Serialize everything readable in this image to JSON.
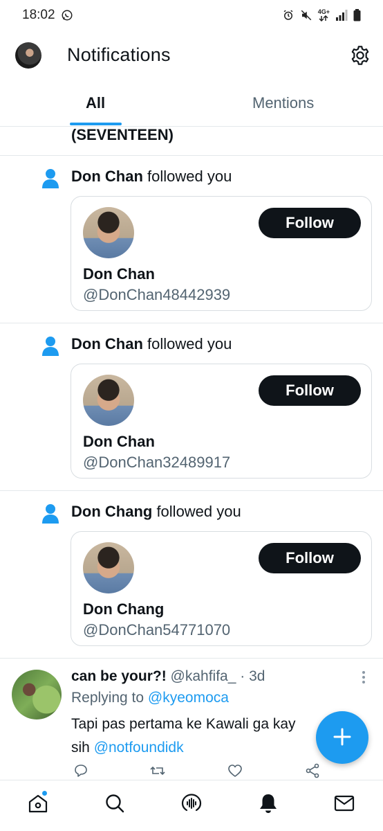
{
  "status_bar": {
    "time": "18:02",
    "network_label": "4G+",
    "icons": [
      "whatsapp-icon",
      "alarm-icon",
      "mute-icon",
      "network-icon",
      "signal-icon",
      "battery-icon"
    ]
  },
  "header": {
    "title": "Notifications",
    "icons": [
      "avatar",
      "gear-icon"
    ]
  },
  "tabs": [
    {
      "label": "All",
      "selected": true
    },
    {
      "label": "Mentions",
      "selected": false
    }
  ],
  "truncated_text": "(SEVENTEEN)",
  "notifications": [
    {
      "actor": "Don Chan",
      "action": " followed you",
      "card": {
        "name": "Don Chan",
        "handle": "@DonChan48442939",
        "button": "Follow"
      }
    },
    {
      "actor": "Don Chan",
      "action": " followed you",
      "card": {
        "name": "Don Chan",
        "handle": "@DonChan32489917",
        "button": "Follow"
      }
    },
    {
      "actor": "Don Chang",
      "action": " followed you",
      "card": {
        "name": "Don Chang",
        "handle": "@DonChan54771070",
        "button": "Follow"
      }
    }
  ],
  "tweet": {
    "display_name": "can be your?!",
    "handle": "@kahfifa_",
    "separator": " · ",
    "time": "3d",
    "replying_label": "Replying to ",
    "replying_to": "@kyeomoca",
    "body_text": "Tapi pas pertama ke Kawali ga kay",
    "body_line2": "sih ",
    "body_mention": "@notfoundidk"
  },
  "fab": {
    "icon": "plus-icon"
  },
  "bottom_nav": [
    {
      "icon": "home-icon",
      "has_dot": true
    },
    {
      "icon": "search-icon"
    },
    {
      "icon": "spaces-icon"
    },
    {
      "icon": "bell-icon",
      "selected": true
    },
    {
      "icon": "mail-icon"
    }
  ],
  "colors": {
    "accent": "#1d9bf0",
    "text": "#0f1419",
    "muted": "#536471",
    "button_bg": "#0f1419",
    "border": "#e4e8eb"
  }
}
